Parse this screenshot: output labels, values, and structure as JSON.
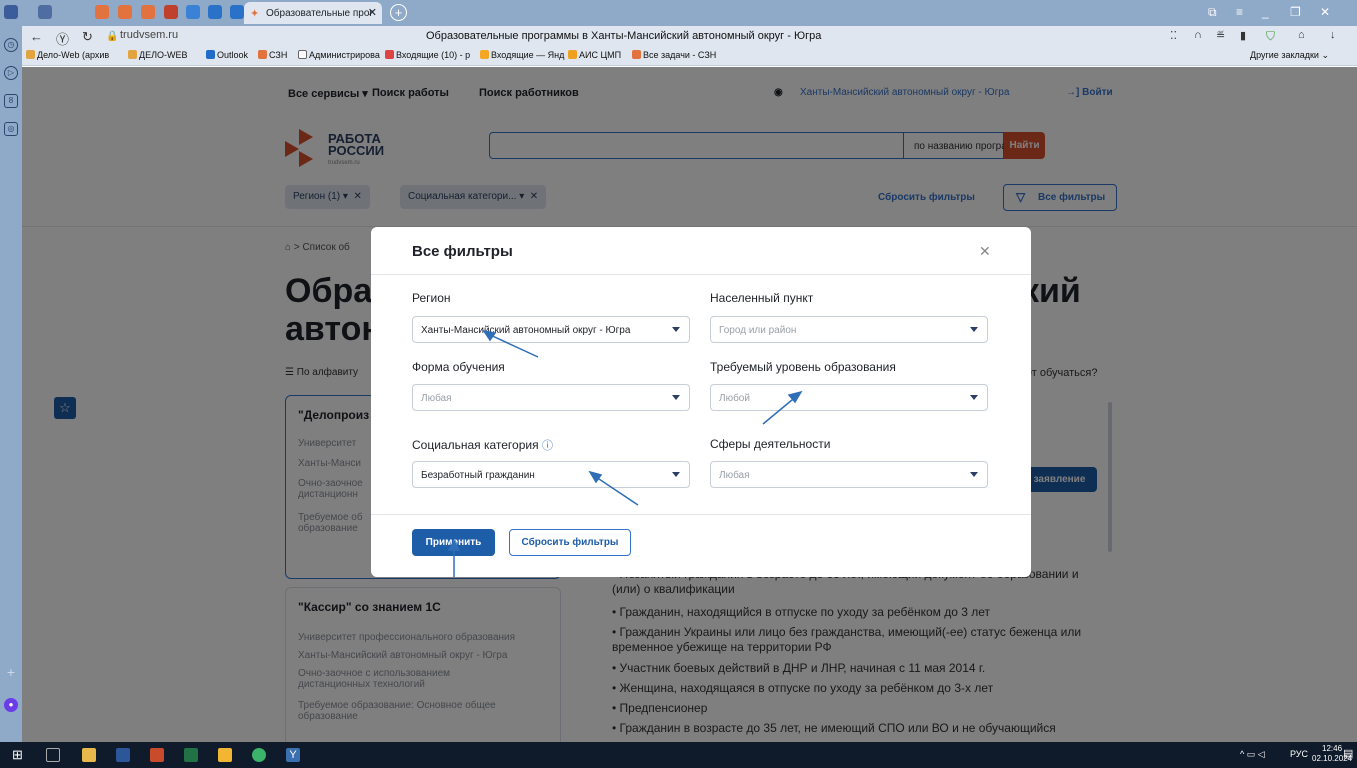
{
  "browser": {
    "tab_title": "Образовательные прог",
    "url": "trudvsem.ru",
    "page_title": "Образовательные программы в Ханты-Мансийский автономный округ - Югра",
    "bookmarks": [
      "Дело-Web (архив",
      "ДЕЛО-WEB",
      "Outlook",
      "СЗН",
      "Администрирова",
      "Входящие (10) - р",
      "Входящие — Янд",
      "АИС ЦМП",
      "Все задачи - СЗН"
    ],
    "other_bookmarks": "Другие закладки"
  },
  "site": {
    "nav": [
      "Все сервисы",
      "Поиск работы",
      "Поиск работников"
    ],
    "region_link": "Ханты-Мансийский автономный округ - Югра",
    "login": "Войти",
    "logo_line1": "РАБОТА",
    "logo_line2": "РОССИИ",
    "logo_sub": "trudvsem.ru",
    "search_mode": "по названию програм...",
    "search_btn": "Найти",
    "chip_region": "Регион (1)",
    "chip_social": "Социальная категори...",
    "reset_filters": "Сбросить фильтры",
    "all_filters": "Все фильтры",
    "breadcrumb": "Список об",
    "heading_left_1": "Образ",
    "heading_left_2": "автон",
    "heading_right": "кий",
    "sort": "По алфавиту",
    "who_question": "ет обучаться?",
    "apply_btn_bg": "заявление"
  },
  "cards": [
    {
      "title": "\"Делопроиз",
      "org": "Университет",
      "region": "Ханты-Манси",
      "form": "Очно-заочное дистанционн",
      "edu": "Требуемое об образование"
    },
    {
      "title": "\"Кассир\" со знанием 1С",
      "org": "Университет профессионального образования",
      "region": "Ханты-Мансийский автономный округ - Югра",
      "form": "Очно-заочное с использованием дистанционных технологий",
      "edu": "Требуемое образование: Основное общее образование"
    }
  ],
  "categories": [
    "Незанятый гражданин в возрасте до 35 лет, имеющий документ об образовании и (или) о квалификации",
    "Гражданин, находящийся в отпуске по уходу за ребёнком до 3 лет",
    "Гражданин Украины или лицо без гражданства, имеющий(-ее) статус беженца или временное убежище на территории РФ",
    "Участник боевых действий в ДНР и ЛНР, начиная с 11 мая 2014 г.",
    "Женщина, находящаяся в отпуске по уходу за ребёнком до 3-х лет",
    "Предпенсионер",
    "Гражданин в возрасте до 35 лет, не имеющий СПО или ВО и не обучающийся"
  ],
  "modal": {
    "title": "Все фильтры",
    "region_label": "Регион",
    "region_value": "Ханты-Мансийский автономный округ - Югра",
    "locality_label": "Населенный пункт",
    "locality_placeholder": "Город или район",
    "form_label": "Форма обучения",
    "form_value": "Любая",
    "edu_label": "Требуемый уровень образования",
    "edu_value": "Любой",
    "social_label": "Социальная категория",
    "social_value": "Безработный гражданин",
    "sphere_label": "Сферы деятельности",
    "sphere_value": "Любая",
    "apply": "Применить",
    "reset": "Сбросить фильтры"
  },
  "taskbar": {
    "lang": "РУС",
    "time": "12:46",
    "date": "02.10.2024"
  },
  "colors": {
    "accent": "#1e5da8",
    "brand_orange": "#d9512c",
    "arrow": "#2f6fb7"
  }
}
